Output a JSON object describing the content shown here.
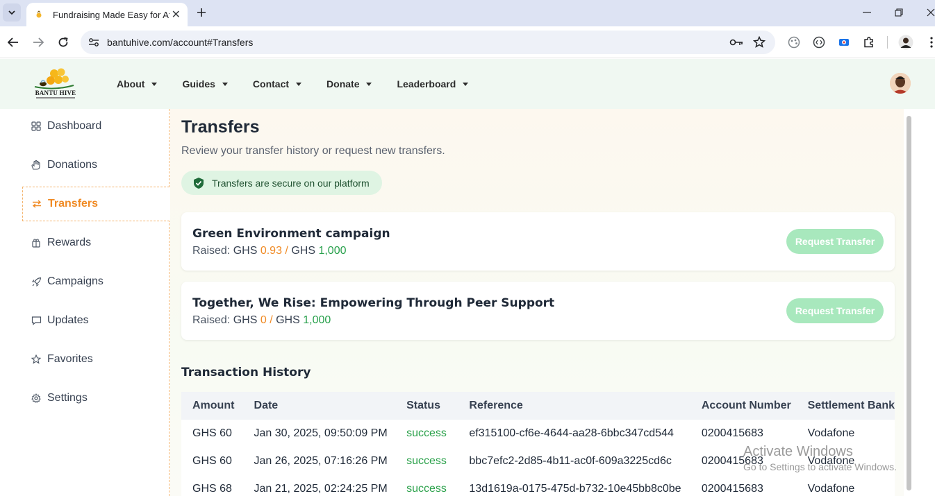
{
  "browser": {
    "tab_title": "Fundraising Made Easy for Afric",
    "url": "bantuhive.com/account#Transfers"
  },
  "site": {
    "logo_text": "BANTU HIVE",
    "nav": [
      {
        "label": "About"
      },
      {
        "label": "Guides"
      },
      {
        "label": "Contact"
      },
      {
        "label": "Donate"
      },
      {
        "label": "Leaderboard"
      }
    ]
  },
  "sidebar": {
    "items": [
      {
        "label": "Dashboard",
        "icon": "grid-icon"
      },
      {
        "label": "Donations",
        "icon": "hand-icon"
      },
      {
        "label": "Transfers",
        "icon": "swap-arrows-icon",
        "active": true
      },
      {
        "label": "Rewards",
        "icon": "gift-icon"
      },
      {
        "label": "Campaigns",
        "icon": "rocket-icon"
      },
      {
        "label": "Updates",
        "icon": "chat-icon"
      },
      {
        "label": "Favorites",
        "icon": "star-icon"
      },
      {
        "label": "Settings",
        "icon": "gear-icon"
      }
    ]
  },
  "main": {
    "title": "Transfers",
    "subtitle": "Review your transfer history or request new transfers.",
    "secure_badge": "Transfers are secure on our platform",
    "campaigns": [
      {
        "name": "Green Environment campaign",
        "raised_label": "Raised:",
        "currency": "GHS",
        "raised": "0.93",
        "separator": "/",
        "goal": "1,000",
        "button": "Request Transfer"
      },
      {
        "name": "Together, We Rise: Empowering Through Peer Support",
        "raised_label": "Raised:",
        "currency": "GHS",
        "raised": "0",
        "separator": "/",
        "goal": "1,000",
        "button": "Request Transfer"
      }
    ],
    "history_title": "Transaction History",
    "table": {
      "headers": [
        "Amount",
        "Date",
        "Status",
        "Reference",
        "Account Number",
        "Settlement Bank"
      ],
      "rows": [
        [
          "GHS 60",
          "Jan 30, 2025, 09:50:09 PM",
          "success",
          "ef315100-cf6e-4644-aa28-6bbc347cd544",
          "0200415683",
          "Vodafone"
        ],
        [
          "GHS 60",
          "Jan 26, 2025, 07:16:26 PM",
          "success",
          "bbc7efc2-2d85-4b11-ac0f-609a3225cd6c",
          "0200415683",
          "Vodafone"
        ],
        [
          "GHS 68",
          "Jan 21, 2025, 02:24:25 PM",
          "success",
          "13d1619a-0175-475d-b732-10e45bb8c0be",
          "0200415683",
          "Vodafone"
        ]
      ]
    }
  },
  "overlay": {
    "line1": "Activate Windows",
    "line2": "Go to Settings to activate Windows."
  },
  "colors": {
    "accent_orange": "#f08a24",
    "success_green": "#27a04b",
    "header_bg": "#f0f8f2",
    "button_green": "#a8e8bd"
  }
}
